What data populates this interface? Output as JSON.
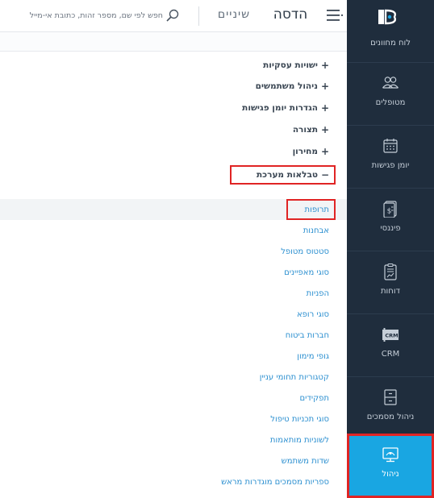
{
  "header": {
    "title": "הדסה",
    "subtitle": "שיניים",
    "search_placeholder": "חפש לפי שם, מספר זהות, כתובת אי-מייל"
  },
  "sidebar": {
    "logo_label": "לוח מחוונים",
    "items": [
      {
        "label": "מטופלים",
        "icon": "patients-icon"
      },
      {
        "label": "יומן פגישות",
        "icon": "calendar-icon"
      },
      {
        "label": "פיננסי",
        "icon": "finance-icon"
      },
      {
        "label": "דוחות",
        "icon": "reports-icon"
      },
      {
        "label": "CRM",
        "icon": "crm-icon"
      },
      {
        "label": "ניהול מסמכים",
        "icon": "documents-icon"
      },
      {
        "label": "ניהול",
        "icon": "admin-icon",
        "active": true
      }
    ]
  },
  "settings_menu": {
    "groups": [
      {
        "sign": "+",
        "label": "ישויות עסקיות"
      },
      {
        "sign": "+",
        "label": "ניהול משתמשים"
      },
      {
        "sign": "+",
        "label": "הגדרות יומן פגישות"
      },
      {
        "sign": "+",
        "label": "תצורה"
      },
      {
        "sign": "+",
        "label": "מחירון"
      },
      {
        "sign": "−",
        "label": "טבלאות מערכת"
      }
    ],
    "system_tables": [
      "תרופות",
      "אבחנות",
      "סטטוס מטופל",
      "סוגי מאפיינים",
      "הפניות",
      "סוגי רופא",
      "חברות ביטוח",
      "גופי מימון",
      "קטגוריות תחומי עניין",
      "תפקידים",
      "סוגי תכניות טיפול",
      "לשוניות מותאמות",
      "שדות משתמש",
      "ספריות מסמכים מוגדרות מראש"
    ]
  },
  "colors": {
    "sidebar_bg": "#1f2d3d",
    "active_bg": "#19a6e2",
    "link": "#2b8fd0",
    "highlight_border": "#e02424"
  }
}
